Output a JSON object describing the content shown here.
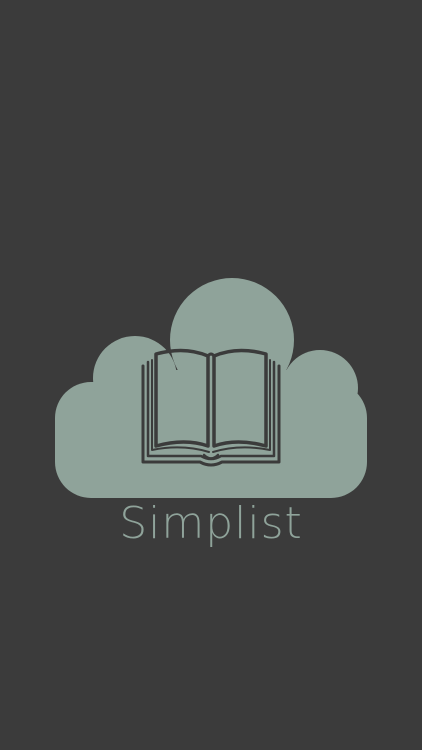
{
  "app": {
    "name": "Simplist"
  },
  "logo": {
    "cloud_icon": "cloud-icon",
    "book_icon": "open-book-icon"
  },
  "colors": {
    "background": "#3b3b3b",
    "cloud": "#8fa39a",
    "book": "#3b3b3b",
    "text": "#8fa39a"
  }
}
